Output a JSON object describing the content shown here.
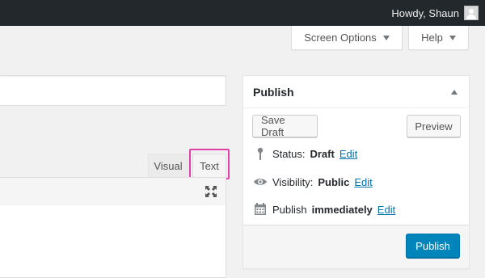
{
  "adminbar": {
    "greeting": "Howdy, Shaun"
  },
  "screen_meta": {
    "screen_options": "Screen Options",
    "help": "Help"
  },
  "editor": {
    "tab_visual": "Visual",
    "tab_text": "Text"
  },
  "publish": {
    "title": "Publish",
    "save_draft": "Save Draft",
    "preview": "Preview",
    "status_label": "Status:",
    "status_value": "Draft",
    "visibility_label": "Visibility:",
    "visibility_value": "Public",
    "schedule_label": "Publish",
    "schedule_value": "immediately",
    "edit": "Edit",
    "publish_button": "Publish"
  },
  "colors": {
    "adminbar_bg": "#23282d",
    "link": "#0073aa",
    "primary_button": "#0085ba",
    "highlight": "#e040a8"
  },
  "icons": [
    "avatar",
    "caret-down-icon",
    "caret-up-icon",
    "fullscreen-icon",
    "pin-icon",
    "eye-icon",
    "calendar-icon"
  ]
}
